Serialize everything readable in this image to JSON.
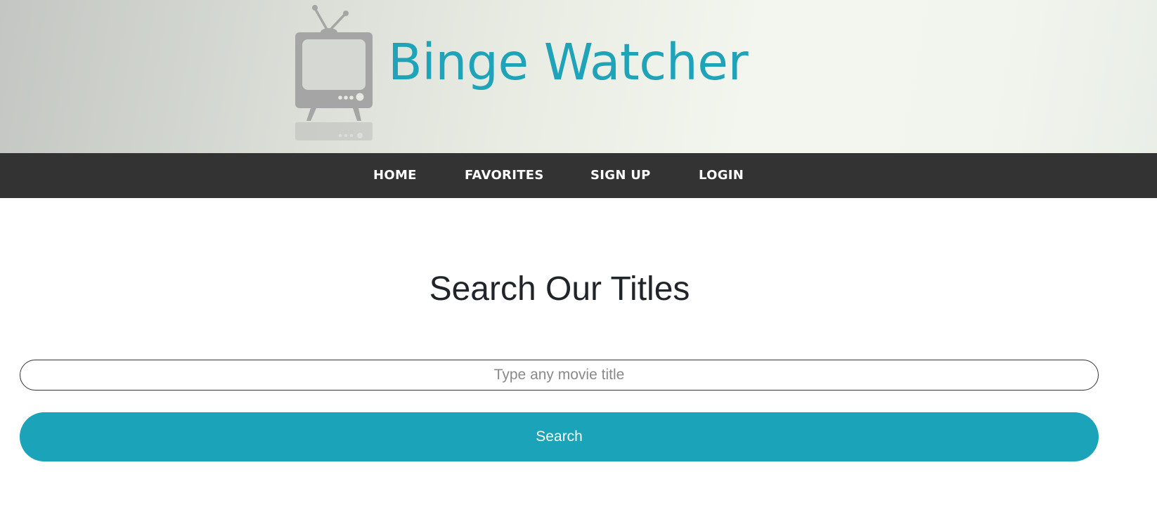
{
  "header": {
    "brand_name": "Binge Watcher",
    "logo_icon": "tv-icon",
    "brand_color": "#1fa3b8"
  },
  "nav": {
    "items": [
      {
        "label": "HOME"
      },
      {
        "label": "FAVORITES"
      },
      {
        "label": "SIGN UP"
      },
      {
        "label": "LOGIN"
      }
    ],
    "background_color": "#333333"
  },
  "main": {
    "title": "Search Our Titles",
    "search": {
      "value": "",
      "placeholder": "Type any movie title"
    },
    "search_button_label": "Search",
    "accent_color": "#1aa3b9"
  }
}
